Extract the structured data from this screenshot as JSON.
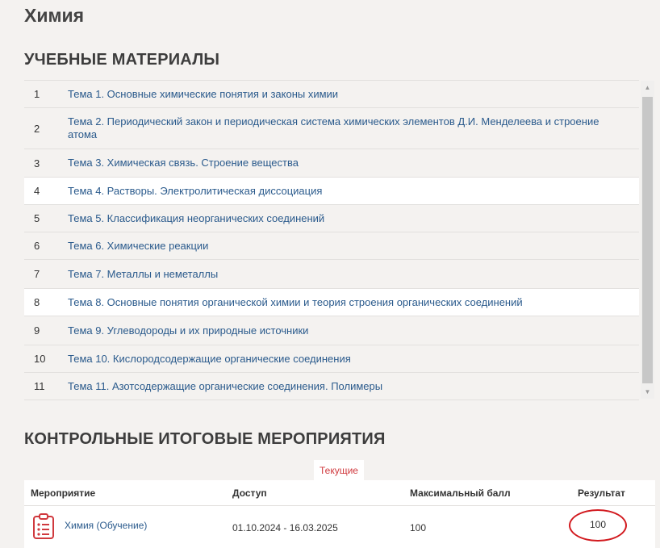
{
  "page_title": "Химия",
  "materials": {
    "title": "УЧЕБНЫЕ МАТЕРИАЛЫ",
    "topics": [
      {
        "num": "1",
        "label": "Тема 1. Основные химические понятия и законы химии"
      },
      {
        "num": "2",
        "label": "Тема 2. Периодический закон и периодическая система химических элементов Д.И. Менделеева и строение атома"
      },
      {
        "num": "3",
        "label": "Тема 3. Химическая связь. Строение вещества"
      },
      {
        "num": "4",
        "label": "Тема 4. Растворы. Электролитическая диссоциация"
      },
      {
        "num": "5",
        "label": "Тема 5. Классификация неорганических соединений"
      },
      {
        "num": "6",
        "label": "Тема 6. Химические реакции"
      },
      {
        "num": "7",
        "label": "Тема 7. Металлы и неметаллы"
      },
      {
        "num": "8",
        "label": "Тема 8. Основные понятия органической химии и теория строения органических соединений"
      },
      {
        "num": "9",
        "label": "Тема 9. Углеводороды и их природные источники"
      },
      {
        "num": "10",
        "label": "Тема 10. Кислородсодержащие органические соединения"
      },
      {
        "num": "11",
        "label": "Тема 11. Азотсодержащие органические соединения. Полимеры"
      }
    ]
  },
  "events": {
    "title": "КОНТРОЛЬНЫЕ ИТОГОВЫЕ МЕРОПРИЯТИЯ",
    "tab_current": "Текущие",
    "columns": {
      "event": "Мероприятие",
      "access": "Доступ",
      "max_score": "Максимальный балл",
      "result": "Результат"
    },
    "rows": [
      {
        "event": "Химия (Обучение)",
        "access": "01.10.2024 - 16.03.2025",
        "max_score": "100",
        "result": "100"
      }
    ]
  },
  "colors": {
    "link": "#2a5a8c",
    "accent_red": "#d0393e",
    "background": "#f4f2f0"
  },
  "icons": {
    "event_icon": "clipboard-checklist-icon",
    "scroll_up": "scroll-up-arrow-icon",
    "scroll_down": "scroll-down-arrow-icon"
  }
}
